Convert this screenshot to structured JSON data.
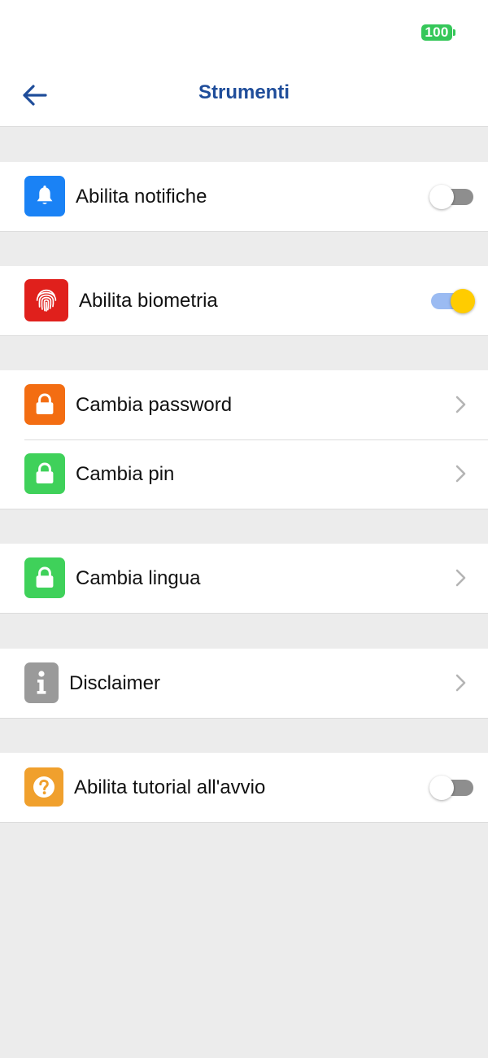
{
  "status_bar": {
    "battery": "100",
    "battery_color": "#35c759"
  },
  "header": {
    "title": "Strumenti",
    "back_icon": "arrow-left-icon",
    "title_color": "#1f4d9a"
  },
  "settings": {
    "notifications": {
      "label": "Abilita notifiche",
      "icon": "bell-icon",
      "icon_color": "#1a82f5",
      "enabled": false
    },
    "biometrics": {
      "label": "Abilita biometria",
      "icon": "fingerprint-icon",
      "icon_color": "#e0201c",
      "enabled": true
    },
    "change_password": {
      "label": "Cambia password",
      "icon": "lock-icon",
      "icon_color": "#f36d12"
    },
    "change_pin": {
      "label": "Cambia pin",
      "icon": "lock-icon",
      "icon_color": "#3fd15a"
    },
    "change_language": {
      "label": "Cambia lingua",
      "icon": "lock-icon",
      "icon_color": "#3fd15a"
    },
    "disclaimer": {
      "label": "Disclaimer",
      "icon": "info-icon",
      "icon_color": "#9a9a9a"
    },
    "tutorial": {
      "label": "Abilita tutorial all'avvio",
      "icon": "question-icon",
      "icon_color": "#f0a02d",
      "enabled": false
    }
  },
  "toggle_colors": {
    "on_track": "#9bbbf2",
    "on_knob": "#ffcc00",
    "off_track": "#8e8e8e",
    "off_knob": "#ffffff"
  }
}
